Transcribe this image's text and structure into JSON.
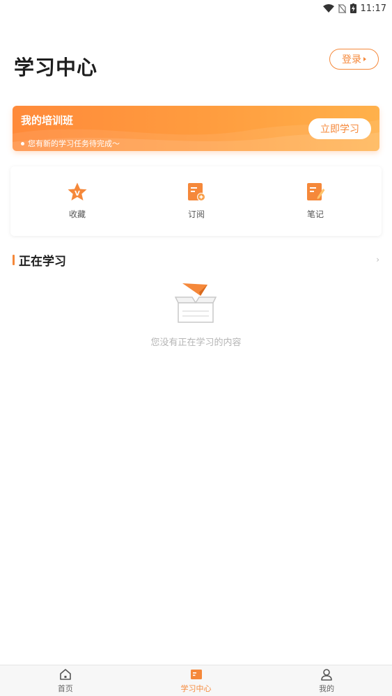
{
  "status_bar": {
    "time": "11:17",
    "icons": [
      "wifi-icon",
      "no-sim-icon",
      "battery-charging-icon"
    ]
  },
  "header": {
    "title": "学习中心",
    "login_label": "登录"
  },
  "banner": {
    "title": "我的培训班",
    "subtitle": "您有新的学习任务待完成～",
    "button_label": "立即学习"
  },
  "quick_actions": [
    {
      "label": "收藏",
      "icon": "favorite-star-icon"
    },
    {
      "label": "订阅",
      "icon": "subscribe-icon"
    },
    {
      "label": "笔记",
      "icon": "note-icon"
    }
  ],
  "section": {
    "title": "正在学习",
    "more_icon": "chevron-right-icon"
  },
  "empty_state": {
    "text": "您没有正在学习的内容",
    "icon": "empty-box-icon"
  },
  "tabbar": {
    "tabs": [
      {
        "label": "首页",
        "icon": "home-icon",
        "active": false
      },
      {
        "label": "学习中心",
        "icon": "study-center-icon",
        "active": true
      },
      {
        "label": "我的",
        "icon": "profile-icon",
        "active": false
      }
    ]
  },
  "colors": {
    "accent": "#f5883a",
    "banner_start": "#ff8a3a",
    "banner_end": "#ffb14b"
  }
}
